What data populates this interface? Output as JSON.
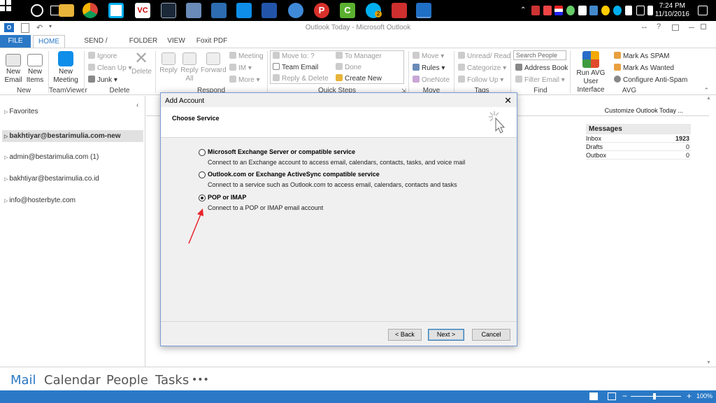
{
  "taskbar": {
    "clock_time": "7:24 PM",
    "clock_date": "11/10/2016",
    "app_icons": [
      "file-explorer-icon",
      "chrome-icon",
      "skype-icon",
      "vc-icon",
      "steam-icon",
      "finder-icon",
      "task-manager-icon",
      "teamviewer-icon",
      "network-icon",
      "vpn-icon",
      "psiphon-icon",
      "camtasia-icon",
      "skype-badge-icon",
      "flag-icon",
      "outlook-icon"
    ],
    "skype_badge": "2"
  },
  "window": {
    "title": "Outlook Today - Microsoft Outlook",
    "help": "?"
  },
  "tabs": [
    "FILE",
    "HOME",
    "SEND / RECEIVE",
    "FOLDER",
    "VIEW",
    "Foxit PDF"
  ],
  "ribbon": {
    "new_email": "New\nEmail",
    "new_email_l1": "New",
    "new_email_l2": "Email",
    "new_items_l1": "New",
    "new_items_l2": "Items",
    "new_meeting_l1": "New",
    "new_meeting_l2": "Meeting",
    "ignore": "Ignore",
    "clean_up": "Clean Up",
    "junk": "Junk",
    "delete": "Delete",
    "reply": "Reply",
    "reply_all_l1": "Reply",
    "reply_all_l2": "All",
    "forward": "Forward",
    "meeting": "Meeting",
    "im": "IM",
    "more": "More",
    "move_to": "Move to: ?",
    "team_email": "Team Email",
    "reply_delete": "Reply & Delete",
    "to_manager": "To Manager",
    "done": "Done",
    "create_new": "Create New",
    "move": "Move",
    "rules": "Rules",
    "onenote": "OneNote",
    "unread_read": "Unread/ Read",
    "categorize": "Categorize",
    "follow_up": "Follow Up",
    "search_people": "Search People",
    "address_book": "Address Book",
    "filter_email": "Filter Email",
    "run_avg_l1": "Run AVG",
    "run_avg_l2": "User Interface",
    "mark_spam": "Mark As SPAM",
    "mark_wanted": "Mark As Wanted",
    "configure_antispam": "Configure Anti-Spam",
    "groups": {
      "new": "New",
      "teamviewer": "TeamViewer",
      "delete": "Delete",
      "respond": "Respond",
      "quick_steps": "Quick Steps",
      "move": "Move",
      "tags": "Tags",
      "find": "Find",
      "avg": "AVG"
    }
  },
  "sidebar": {
    "favorites": "Favorites",
    "accounts": [
      "bakhtiyar@bestarimulia.com-new",
      "admin@bestarimulia.com (1)",
      "bakhtiyar@bestarimulia.co.id",
      "info@hosterbyte.com"
    ]
  },
  "content": {
    "customize": "Customize Outlook Today ...",
    "messages": {
      "header": "Messages",
      "rows": [
        {
          "label": "Inbox",
          "value": "1923"
        },
        {
          "label": "Drafts",
          "value": "0"
        },
        {
          "label": "Outbox",
          "value": "0"
        }
      ]
    }
  },
  "bottom_nav": [
    "Mail",
    "Calendar",
    "People",
    "Tasks",
    "•••"
  ],
  "status": {
    "zoom": "100%"
  },
  "dialog": {
    "title": "Add Account",
    "subtitle": "Choose Service",
    "options": [
      {
        "label": "Microsoft Exchange Server or compatible service",
        "desc": "Connect to an Exchange account to access email, calendars, contacts, tasks, and voice mail",
        "selected": false
      },
      {
        "label": "Outlook.com or Exchange ActiveSync compatible service",
        "desc": "Connect to a service such as Outlook.com to access email, calendars, contacts and tasks",
        "selected": false
      },
      {
        "label": "POP or IMAP",
        "desc": "Connect to a POP or IMAP email account",
        "selected": true
      }
    ],
    "back": "< Back",
    "next": "Next >",
    "cancel": "Cancel"
  },
  "colors": {
    "accent": "#2b79c6",
    "annotation_arrow": "#e8242b"
  }
}
